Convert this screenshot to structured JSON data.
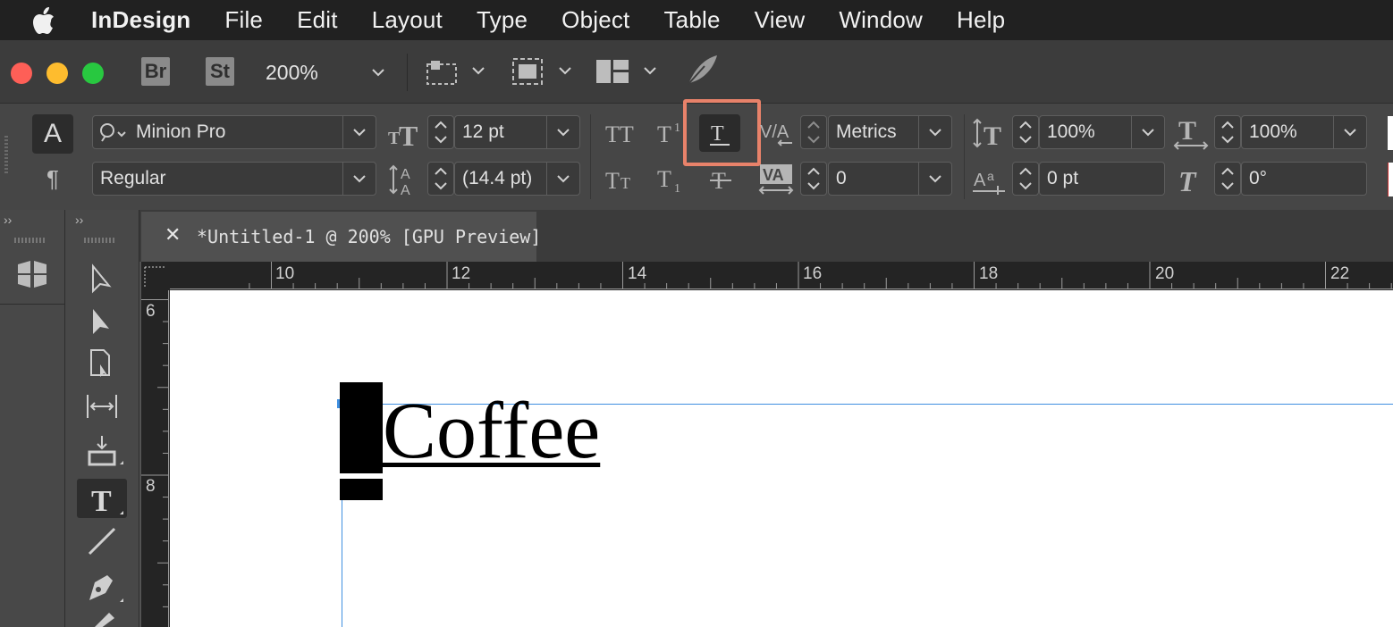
{
  "menubar": {
    "app_name": "InDesign",
    "items": [
      "File",
      "Edit",
      "Layout",
      "Type",
      "Object",
      "Table",
      "View",
      "Window",
      "Help"
    ]
  },
  "toolbar": {
    "bridge_label": "Br",
    "stock_label": "St",
    "zoom": "200%"
  },
  "control_panel": {
    "font_family": "Minion Pro",
    "font_style": "Regular",
    "font_size": "12 pt",
    "leading": "(14.4 pt)",
    "kerning": "Metrics",
    "tracking": "0",
    "vertical_scale": "100%",
    "horizontal_scale": "100%",
    "baseline_shift": "0 pt",
    "skew": "0°",
    "character_mode_label": "A",
    "paragraph_mode_label": "¶",
    "highlighted_button": "underline-button"
  },
  "document": {
    "tab_title": "*Untitled-1 @ 200% [GPU Preview]",
    "text": "Coffee",
    "h_ruler": [
      "10",
      "12",
      "14",
      "16",
      "18",
      "20",
      "22"
    ],
    "v_ruler": [
      "6",
      "8"
    ]
  },
  "colors": {
    "highlight": "#e8826a",
    "guide": "#3f8fe0"
  }
}
